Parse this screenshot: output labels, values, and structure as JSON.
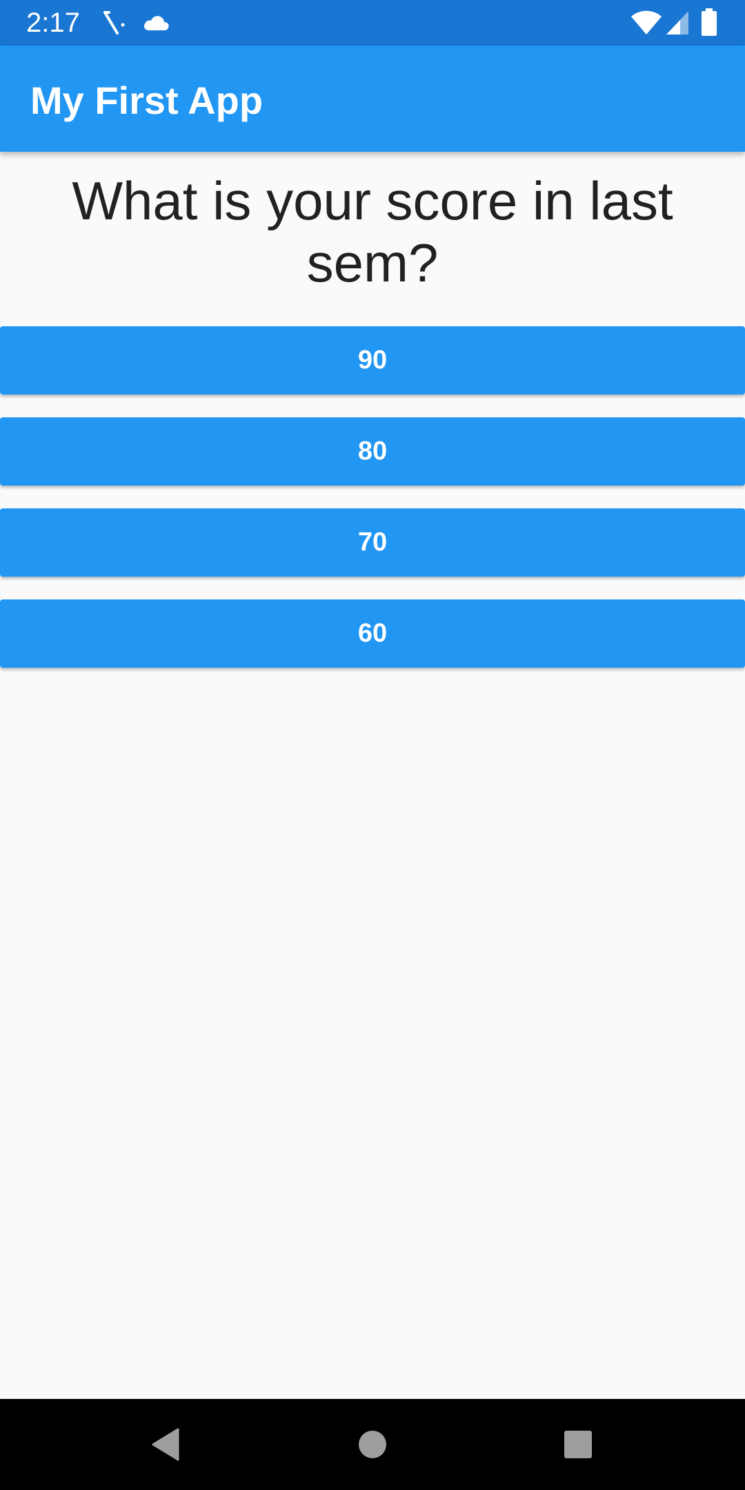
{
  "status_bar": {
    "time": "2:17",
    "icons": [
      "debug-icon",
      "cloud-icon",
      "wifi-icon",
      "signal-icon",
      "battery-icon"
    ],
    "color": "#1976d2"
  },
  "app_bar": {
    "title": "My First App",
    "color": "#2196f3"
  },
  "question": {
    "text": "What is your score in last sem?"
  },
  "answers": [
    {
      "label": "90"
    },
    {
      "label": "80"
    },
    {
      "label": "70"
    },
    {
      "label": "60"
    }
  ],
  "nav_bar": {
    "buttons": [
      "back-icon",
      "home-icon",
      "recents-icon"
    ]
  }
}
